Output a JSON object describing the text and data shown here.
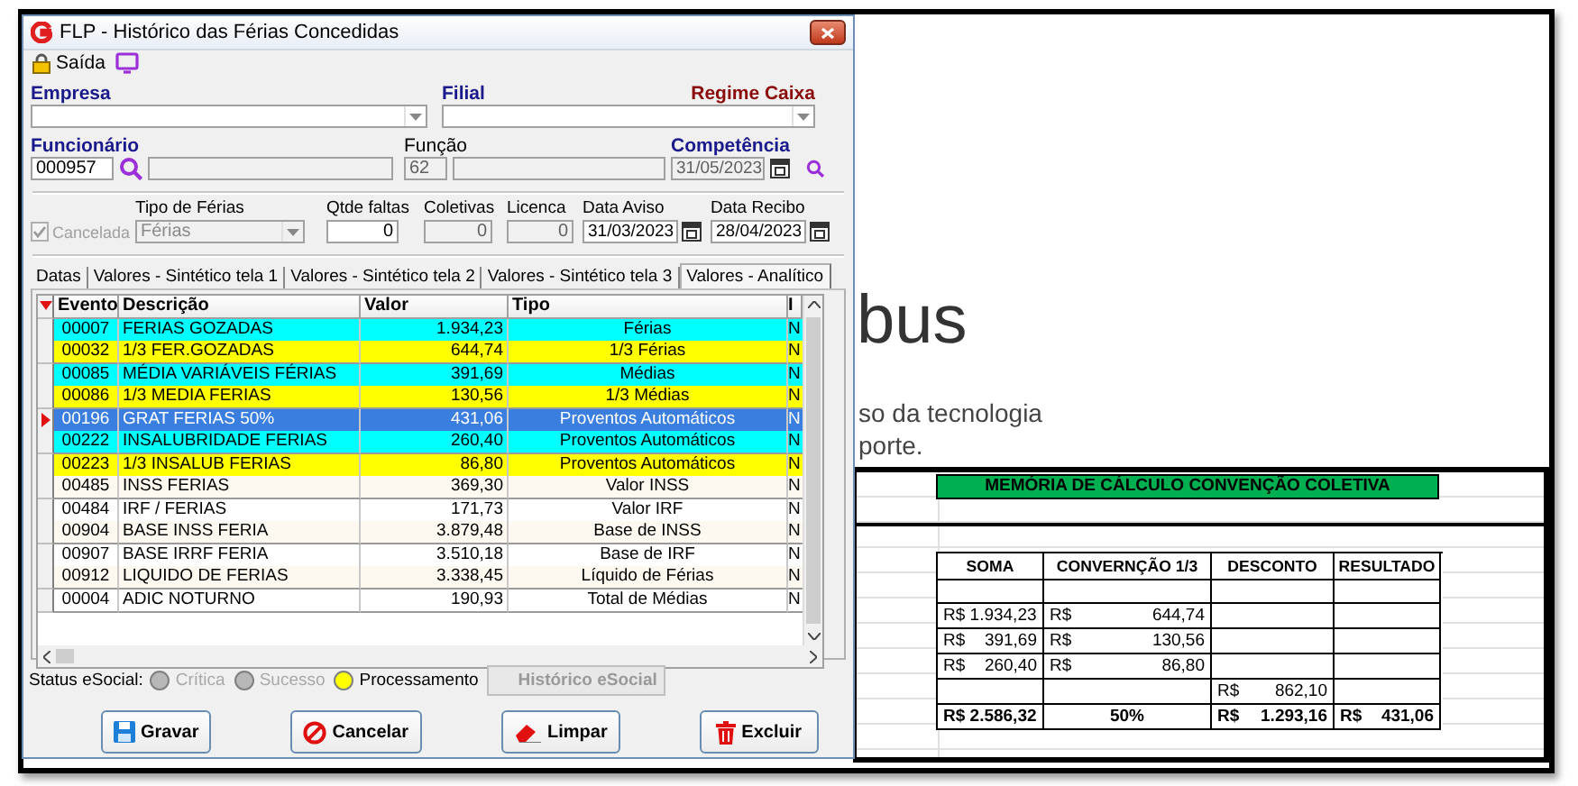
{
  "dialog": {
    "title": "FLP - Histórico das Férias Concedidas",
    "toolbar": {
      "exit_label": "Saída"
    },
    "empresa": {
      "label": "Empresa"
    },
    "filial": {
      "label": "Filial"
    },
    "regime_caixa": {
      "label": "Regime Caixa"
    },
    "funcionario": {
      "label": "Funcionário",
      "value": "000957"
    },
    "funcao": {
      "label": "Função",
      "value": "62"
    },
    "competencia": {
      "label": "Competência",
      "value": "31/05/2023",
      "disabled": true
    },
    "cancelada": {
      "label": "Cancelada",
      "checked": true,
      "disabled": true
    },
    "fields": [
      {
        "kind": "combo",
        "label": "Tipo de Férias",
        "value": "Férias",
        "disabled": true
      },
      {
        "kind": "number",
        "label": "Qtde faltas",
        "value": "0",
        "disabled": false
      },
      {
        "kind": "number",
        "label": "Coletivas",
        "value": "0",
        "disabled": true
      },
      {
        "kind": "number",
        "label": "Licenca",
        "value": "0",
        "disabled": true
      },
      {
        "kind": "date",
        "label": "Data Aviso",
        "value": "31/03/2023",
        "disabled": false
      },
      {
        "kind": "date",
        "label": "Data Recibo",
        "value": "28/04/2023",
        "disabled": false
      }
    ],
    "tabs": [
      {
        "label": "Datas",
        "selected": false
      },
      {
        "label": "Valores - Sintético tela 1",
        "selected": false
      },
      {
        "label": "Valores - Sintético tela 2",
        "selected": false
      },
      {
        "label": "Valores - Sintético tela 3",
        "selected": false
      },
      {
        "label": "Valores - Analítico",
        "selected": true
      }
    ],
    "table": {
      "columns": [
        "Evento",
        "Descrição",
        "Valor",
        "Tipo",
        "I"
      ],
      "rows": [
        {
          "evento": "00007",
          "descricao": "FERIAS GOZADAS",
          "valor": "1.934,23",
          "tipo": "Férias",
          "column_5": "N",
          "color": "#00ffff",
          "selected": false
        },
        {
          "evento": "00032",
          "descricao": "1/3 FER.GOZADAS",
          "valor": "644,74",
          "tipo": "1/3 Férias",
          "column_5": "N",
          "color": "#ffff00",
          "selected": false
        },
        {
          "evento": "00085",
          "descricao": "MÉDIA VARIÁVEIS FÉRIAS",
          "valor": "391,69",
          "tipo": "Médias",
          "column_5": "N",
          "color": "#00ffff",
          "selected": false
        },
        {
          "evento": "00086",
          "descricao": "1/3 MEDIA FERIAS",
          "valor": "130,56",
          "tipo": "1/3 Médias",
          "column_5": "N",
          "color": "#ffff00",
          "selected": false
        },
        {
          "evento": "00196",
          "descricao": "GRAT FERIAS 50%",
          "valor": "431,06",
          "tipo": "Proventos Automáticos",
          "column_5": "N",
          "color": "#3a7ee0",
          "selected": true
        },
        {
          "evento": "00222",
          "descricao": "INSALUBRIDADE FERIAS",
          "valor": "260,40",
          "tipo": "Proventos Automáticos",
          "column_5": "N",
          "color": "#00ffff",
          "selected": false
        },
        {
          "evento": "00223",
          "descricao": "1/3 INSALUB FERIAS",
          "valor": "86,80",
          "tipo": "Proventos Automáticos",
          "column_5": "N",
          "color": "#ffff00",
          "selected": false
        },
        {
          "evento": "00485",
          "descricao": "INSS FERIAS",
          "valor": "369,30",
          "tipo": "Valor INSS",
          "column_5": "N",
          "color": "#fdf9f0",
          "selected": false
        },
        {
          "evento": "00484",
          "descricao": "IRF / FERIAS",
          "valor": "171,73",
          "tipo": "Valor IRF",
          "column_5": "N",
          "color": "#ffffff",
          "selected": false
        },
        {
          "evento": "00904",
          "descricao": "BASE INSS FERIA",
          "valor": "3.879,48",
          "tipo": "Base de INSS",
          "column_5": "N",
          "color": "#fdf9f0",
          "selected": false
        },
        {
          "evento": "00907",
          "descricao": "BASE IRRF FERIA",
          "valor": "3.510,18",
          "tipo": "Base de IRF",
          "column_5": "N",
          "color": "#ffffff",
          "selected": false
        },
        {
          "evento": "00912",
          "descricao": "LIQUIDO DE FERIAS",
          "valor": "3.338,45",
          "tipo": "Líquido de Férias",
          "column_5": "N",
          "color": "#fdf9f0",
          "selected": false
        },
        {
          "evento": "00004",
          "descricao": "ADIC NOTURNO",
          "valor": "190,93",
          "tipo": "Total de Médias",
          "column_5": "N",
          "color": "#ffffff",
          "selected": false
        }
      ]
    },
    "status": {
      "label": "Status eSocial:",
      "options": [
        {
          "label": "Crítica",
          "color": "#b8b8b8",
          "disabled": true
        },
        {
          "label": "Sucesso",
          "color": "#b8b8b8",
          "disabled": true
        },
        {
          "label": "Processamento",
          "color": "#ffff00",
          "disabled": false
        }
      ],
      "history_button": {
        "label": "Histórico eSocial",
        "disabled": true
      }
    },
    "buttons": [
      {
        "label": "Gravar",
        "kind": "save"
      },
      {
        "label": "Cancelar",
        "kind": "cancel"
      },
      {
        "label": "Limpar",
        "kind": "clear"
      },
      {
        "label": "Excluir",
        "kind": "delete"
      }
    ]
  },
  "webpage": {
    "heading": "bus",
    "lines": [
      "so da tecnologia",
      "porte."
    ]
  },
  "spreadsheet": {
    "title": "MEMÓRIA DE CÁLCULO CONVENÇÃO COLETIVA",
    "columns": [
      "SOMA",
      "CONVERNÇÃO 1/3",
      "DESCONTO",
      "RESULTADO"
    ],
    "rows": [
      {
        "kind": "blank",
        "cells": [
          {},
          {},
          {},
          {}
        ]
      },
      {
        "kind": "normal",
        "cells": [
          {
            "value": "R$ 1.934,23"
          },
          {
            "currency": "R$",
            "value": "644,74"
          },
          {},
          {}
        ]
      },
      {
        "kind": "normal",
        "cells": [
          {
            "currency": "R$",
            "value": "391,69"
          },
          {
            "currency": "R$",
            "value": "130,56"
          },
          {},
          {}
        ]
      },
      {
        "kind": "normal",
        "cells": [
          {
            "currency": "R$",
            "value": "260,40"
          },
          {
            "currency": "R$",
            "value": "86,80"
          },
          {},
          {}
        ]
      },
      {
        "kind": "normal",
        "cells": [
          {},
          {},
          {
            "currency": "R$",
            "value": "862,10"
          },
          {}
        ]
      },
      {
        "kind": "total",
        "cells": [
          {
            "value": "R$ 2.586,32"
          },
          {
            "value": "50%"
          },
          {
            "currency": "R$",
            "value": "1.293,16"
          },
          {
            "currency": "R$",
            "value": "431,06"
          }
        ]
      }
    ]
  }
}
